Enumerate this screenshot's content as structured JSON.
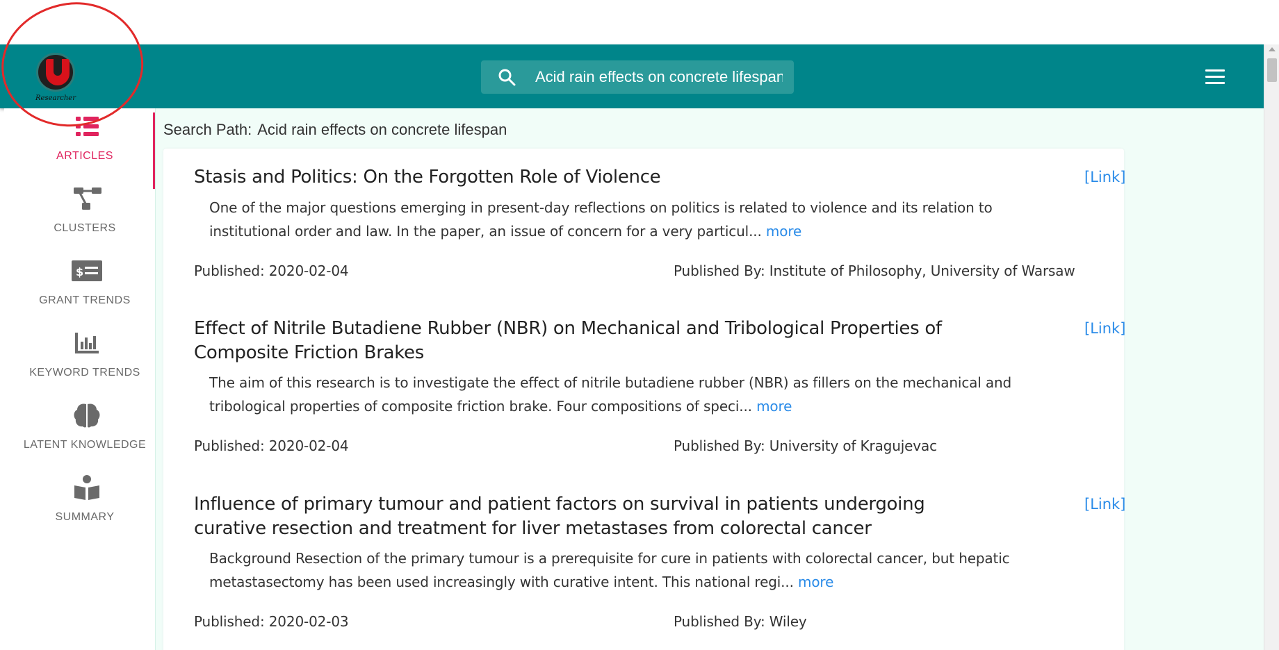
{
  "app": {
    "logo_text": "Researcher",
    "logo_letter": "U"
  },
  "search": {
    "value": "Acid rain effects on concrete lifespan",
    "icon": "search-icon"
  },
  "header": {
    "menu_icon": "hamburger-menu-icon"
  },
  "sidebar": {
    "items": [
      {
        "label": "ARTICLES",
        "icon": "list-icon",
        "active": true
      },
      {
        "label": "CLUSTERS",
        "icon": "sitemap-icon",
        "active": false
      },
      {
        "label": "GRANT TRENDS",
        "icon": "money-check-icon",
        "active": false
      },
      {
        "label": "KEYWORD TRENDS",
        "icon": "bar-chart-icon",
        "active": false
      },
      {
        "label": "LATENT KNOWLEDGE",
        "icon": "brain-icon",
        "active": false
      },
      {
        "label": "SUMMARY",
        "icon": "book-reader-icon",
        "active": false
      }
    ]
  },
  "main": {
    "path_label": "Search Path:",
    "path_value": "Acid rain effects on concrete lifespan",
    "articles": [
      {
        "title": "Stasis and Politics: On the Forgotten Role of Violence",
        "link_label": "[Link]",
        "abstract": "One of the major questions emerging in present-day reflections on politics is related to violence and its relation to institutional order and law. In the paper, an issue of concern for a very particul...",
        "more_label": "more",
        "published": "Published: 2020-02-04",
        "published_by": "Published By: Institute of Philosophy, University of Warsaw"
      },
      {
        "title": "Effect of Nitrile Butadiene Rubber (NBR) on Mechanical and Tribological Properties of Composite Friction Brakes",
        "link_label": "[Link]",
        "abstract": "The aim of this research is to investigate the effect of nitrile butadiene rubber (NBR) as fillers on the mechanical and tribological properties of composite friction brake. Four compositions of speci...",
        "more_label": "more",
        "published": "Published: 2020-02-04",
        "published_by": "Published By: University of Kragujevac"
      },
      {
        "title": "Influence of primary tumour and patient factors on survival in patients undergoing curative resection and treatment for liver metastases from colorectal cancer",
        "link_label": "[Link]",
        "abstract": "Background Resection of the primary tumour is a prerequisite for cure in patients with colorectal cancer, but hepatic metastasectomy has been used increasingly with curative intent. This national regi...",
        "more_label": "more",
        "published": "Published: 2020-02-03",
        "published_by": "Published By: Wiley"
      }
    ]
  },
  "colors": {
    "header": "#00858a",
    "accent": "#e0245e",
    "link": "#2a8be8",
    "main_bg": "#f1fdf8",
    "annotation": "#e22a2a"
  }
}
